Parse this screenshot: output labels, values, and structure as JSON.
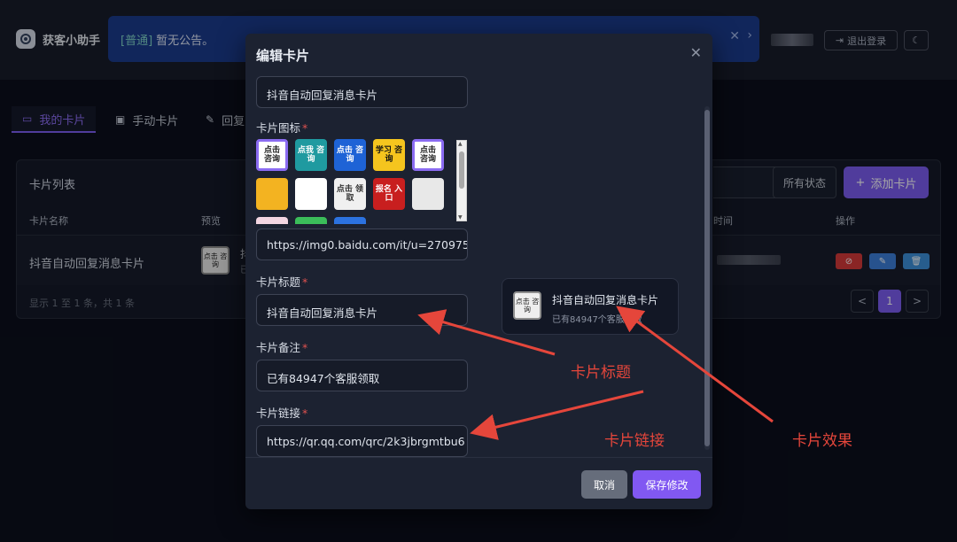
{
  "app": {
    "brand": "获客小助手",
    "announcement": {
      "tag": "[普通]",
      "text": "暂无公告。"
    },
    "logout_label": "退出登录"
  },
  "tabs": [
    {
      "label": "我的卡片",
      "icon": "card-icon"
    },
    {
      "label": "手动卡片",
      "icon": "image-icon"
    },
    {
      "label": "回复",
      "icon": "edit-icon"
    }
  ],
  "panel": {
    "title": "卡片列表",
    "status_filter": "所有状态",
    "add_button": "添加卡片",
    "columns": [
      "卡片名称",
      "预览",
      "时间",
      "操作"
    ],
    "rows": [
      {
        "name": "抖音自动回复消息卡片",
        "thumb_text": "点击 咨询",
        "title_peek": "抖",
        "sub_peek": "已"
      }
    ],
    "pager_info": "显示 1 至 1 条，共 1 条",
    "pages": {
      "prev": "<",
      "current": "1",
      "next": ">"
    }
  },
  "modal": {
    "title": "编辑卡片",
    "name_value": "抖音自动回复消息卡片",
    "icon_label": "卡片图标",
    "icon_url": "https://img0.baidu.com/it/u=270975",
    "title_label": "卡片标题",
    "title_value": "抖音自动回复消息卡片",
    "note_label": "卡片备注",
    "note_value": "已有84947个客服领取",
    "link_label": "卡片链接",
    "link_value": "https://qr.qq.com/qrc/2k3jbrgmtbu6",
    "required_mark": "*",
    "icons": [
      {
        "text": "点击 咨询",
        "bg": "#ffffff",
        "fg": "#222222",
        "selected": true
      },
      {
        "text": "点我 咨询",
        "bg": "#1f9aa0",
        "fg": "#ffffff",
        "selected": false
      },
      {
        "text": "点击 咨询",
        "bg": "#1e63d6",
        "fg": "#ffffff",
        "selected": false
      },
      {
        "text": "学习 咨询",
        "bg": "#f5c51e",
        "fg": "#111111",
        "selected": false
      },
      {
        "text": "点击 咨询",
        "bg": "#ffffff",
        "fg": "#222222",
        "selected": true
      },
      {
        "text": "",
        "bg": "#f3b321",
        "fg": "#111111",
        "selected": false
      },
      {
        "text": "",
        "bg": "#ffffff",
        "fg": "#c82323",
        "selected": false
      },
      {
        "text": "点击 领取",
        "bg": "#f0f0f0",
        "fg": "#333333",
        "selected": false
      },
      {
        "text": "报名 入口",
        "bg": "#c81f1f",
        "fg": "#ffffff",
        "selected": false
      },
      {
        "text": "",
        "bg": "#e8e8e8",
        "fg": "#333333",
        "selected": false
      }
    ],
    "preview": {
      "thumb_text": "点击 咨询",
      "title": "抖音自动回复消息卡片",
      "subtitle": "已有84947个客服领取"
    },
    "cancel_label": "取消",
    "save_label": "保存修改"
  },
  "annotations": {
    "title_note": "卡片标题",
    "link_note": "卡片链接",
    "effect_note": "卡片效果",
    "color": "#e5463b"
  }
}
